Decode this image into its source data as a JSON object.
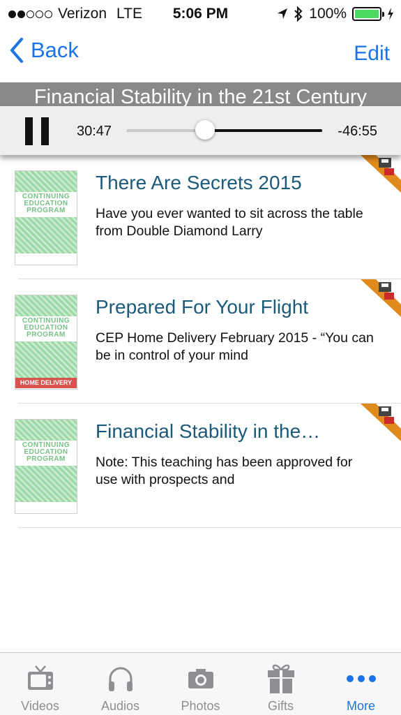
{
  "status_bar": {
    "carrier": "Verizon",
    "network": "LTE",
    "time": "5:06 PM",
    "battery": "100%",
    "signal_bars_filled": 2,
    "signal_bars_total": 5
  },
  "nav": {
    "back_label": "Back",
    "edit_label": "Edit"
  },
  "now_playing": {
    "title": "Financial Stability in the 21st Century",
    "elapsed": "30:47",
    "remaining": "-46:55",
    "progress_fraction": 0.4
  },
  "items": [
    {
      "title": "There Are Secrets 2015",
      "description": "Have you ever wanted to sit across the table from Double Diamond Larry",
      "thumb_text": "CONTINUING EDUCATION PROGRAM",
      "badge": ""
    },
    {
      "title": "Prepared For Your Flight",
      "description": "CEP Home Delivery February 2015 - “You can be in control of your mind",
      "thumb_text": "CONTINUING EDUCATION PROGRAM",
      "badge": "HOME DELIVERY"
    },
    {
      "title": "Financial Stability in the…",
      "description": "Note: This teaching has been approved for use with prospects and",
      "thumb_text": "CONTINUING EDUCATION PROGRAM",
      "badge": ""
    }
  ],
  "tabs": [
    {
      "label": "Videos",
      "icon": "tv-icon",
      "active": false
    },
    {
      "label": "Audios",
      "icon": "headphones-icon",
      "active": false
    },
    {
      "label": "Photos",
      "icon": "camera-icon",
      "active": false
    },
    {
      "label": "Gifts",
      "icon": "gift-icon",
      "active": false
    },
    {
      "label": "More",
      "icon": "more-icon",
      "active": true
    }
  ],
  "colors": {
    "accent": "#1a73e8",
    "title_text": "#1b5a7a",
    "badge_red": "#d9534f",
    "thumb_green": "#74c383",
    "corner_orange": "#e08a1e"
  }
}
